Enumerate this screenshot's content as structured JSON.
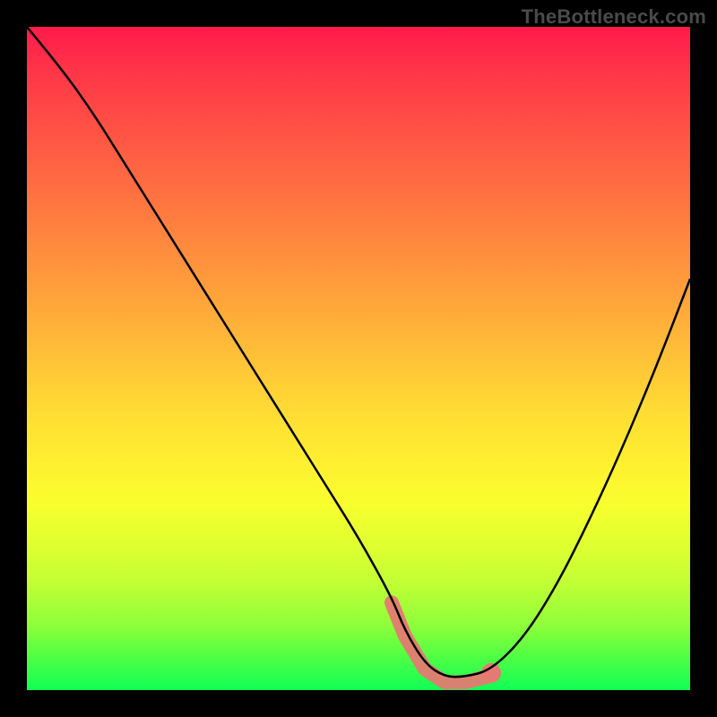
{
  "watermark": "TheBottleneck.com",
  "colors": {
    "gradient_top": "#ff1a4b",
    "gradient_bottom": "#10ff55",
    "curve": "#000000",
    "highlight": "#e47a72",
    "frame": "#000000"
  },
  "chart_data": {
    "type": "line",
    "title": "",
    "xlabel": "",
    "ylabel": "",
    "xlim": [
      0,
      100
    ],
    "ylim": [
      0,
      100
    ],
    "grid": false,
    "legend": false,
    "series": [
      {
        "name": "bottleneck-curve",
        "x": [
          0,
          5,
          10,
          15,
          20,
          25,
          30,
          35,
          40,
          45,
          50,
          55,
          57,
          60,
          63,
          66,
          70,
          75,
          80,
          85,
          90,
          95,
          100
        ],
        "y": [
          100,
          94,
          87,
          79,
          71,
          63,
          55,
          47,
          39,
          31,
          23,
          14,
          9,
          4,
          2,
          2,
          3,
          8,
          16,
          26,
          37,
          49,
          62
        ]
      }
    ],
    "annotations": [
      {
        "name": "optimal-range",
        "x_start": 55,
        "x_end": 70,
        "note": "highlighted pink band near minimum"
      }
    ]
  }
}
